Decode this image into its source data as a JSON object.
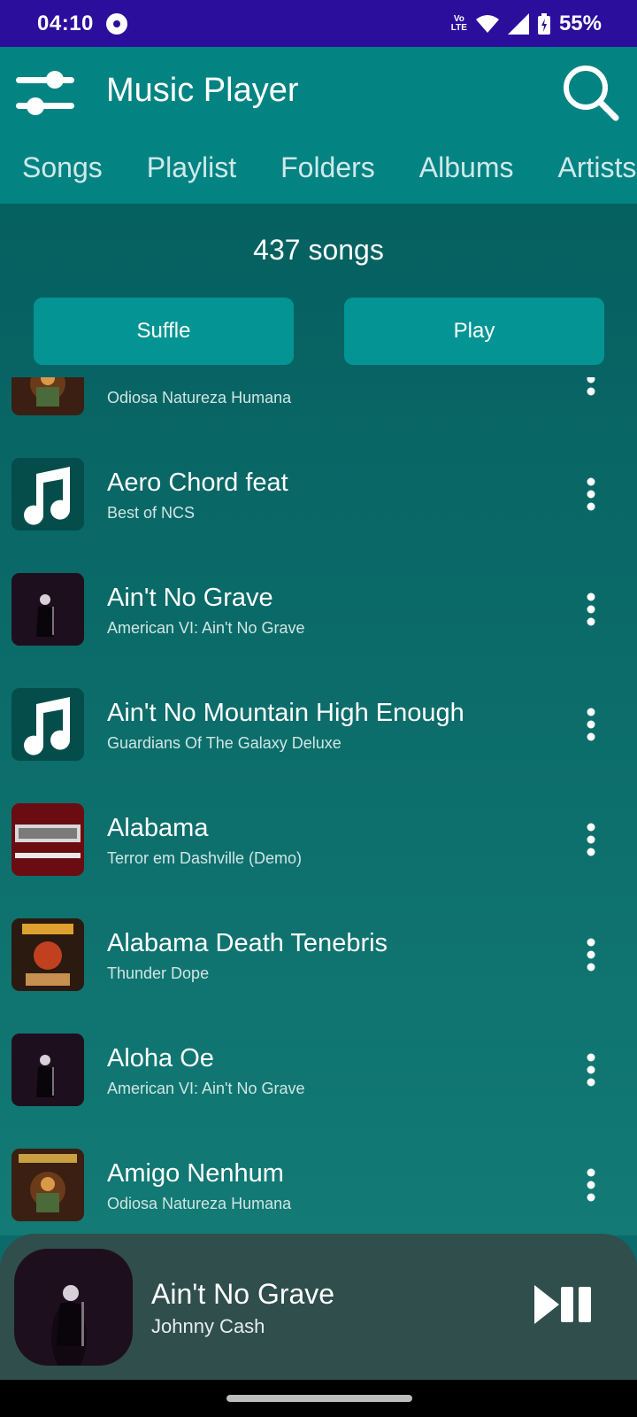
{
  "status_bar": {
    "time": "04:10",
    "network_label": "Vo LTE",
    "battery": "55%"
  },
  "app_bar": {
    "title": "Music Player",
    "tabs": [
      "Songs",
      "Playlist",
      "Folders",
      "Albums",
      "Artists"
    ]
  },
  "main": {
    "song_count": "437 songs",
    "shuffle_label": "Suffle",
    "play_label": "Play"
  },
  "songs": [
    {
      "title": "",
      "subtitle": "Odiosa Natureza Humana",
      "art": "matanza-odiosa"
    },
    {
      "title": "Aero Chord feat",
      "subtitle": "Best of NCS",
      "art": "music-note-placeholder"
    },
    {
      "title": "Ain't No Grave",
      "subtitle": "American VI: Ain't No Grave",
      "art": "johnny-cash-stage"
    },
    {
      "title": "Ain't No Mountain High Enough",
      "subtitle": "Guardians Of The Galaxy Deluxe",
      "art": "music-note-placeholder"
    },
    {
      "title": "Alabama",
      "subtitle": "Terror em Dashville (Demo)",
      "art": "matanza-terror"
    },
    {
      "title": "Alabama Death Tenebris",
      "subtitle": "Thunder Dope",
      "art": "matanza-dope"
    },
    {
      "title": "Aloha Oe",
      "subtitle": "American VI: Ain't No Grave",
      "art": "johnny-cash-stage"
    },
    {
      "title": "Amigo Nenhum",
      "subtitle": "Odiosa Natureza Humana",
      "art": "matanza-odiosa"
    }
  ],
  "now_playing": {
    "title": "Ain't No Grave",
    "artist": "Johnny Cash"
  },
  "colors": {
    "status_bar": "#2c0e9c",
    "app_bar": "#048383",
    "button": "#049494",
    "mini_player": "#2f4e4c"
  }
}
